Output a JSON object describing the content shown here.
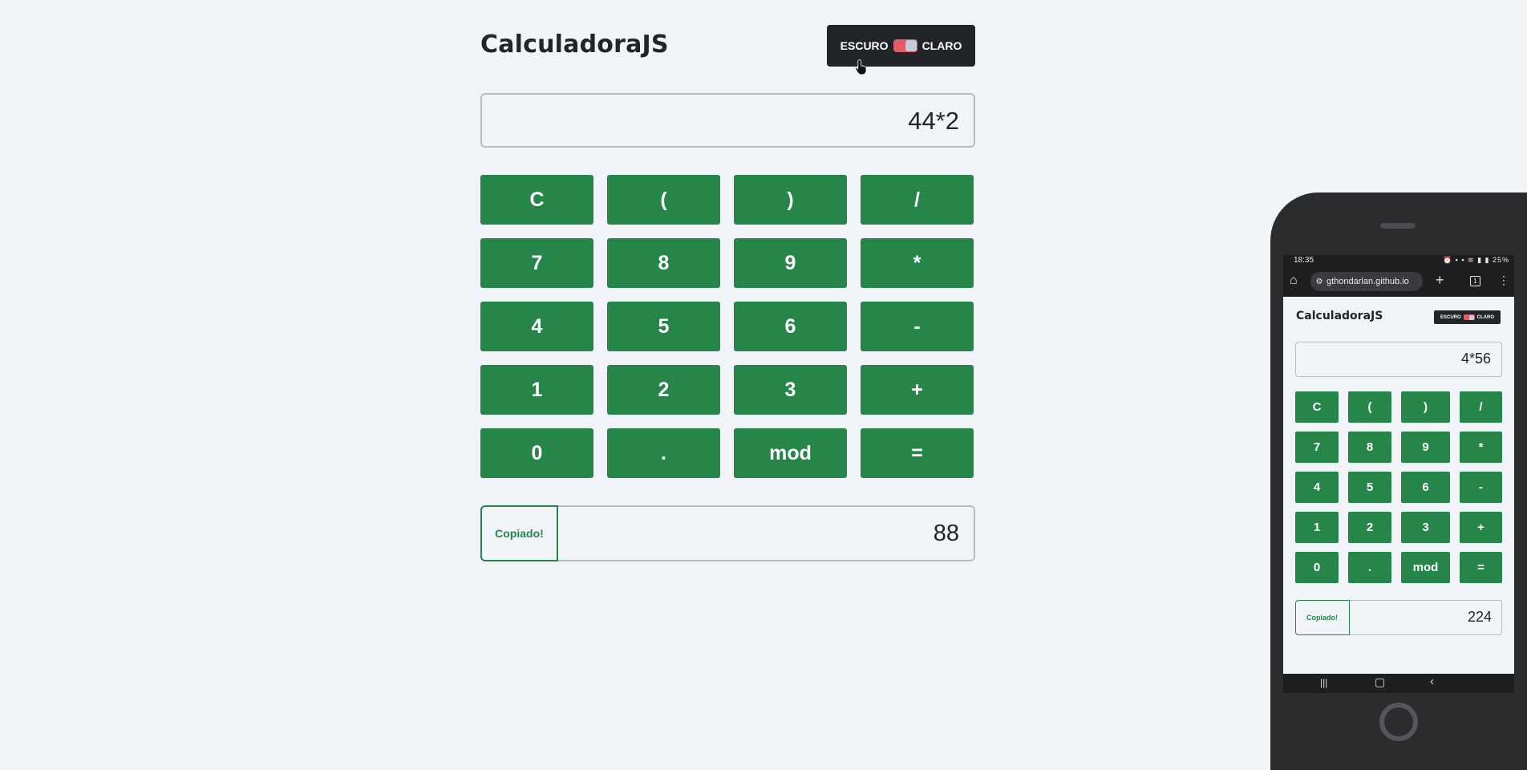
{
  "app": {
    "title": "CalculadoraJS",
    "theme_toggle": {
      "dark_label": "ESCURO",
      "light_label": "CLARO"
    },
    "expression": "44*2",
    "keys": [
      "C",
      "(",
      ")",
      "/",
      "7",
      "8",
      "9",
      "*",
      "4",
      "5",
      "6",
      "-",
      "1",
      "2",
      "3",
      "+",
      "0",
      ".",
      "mod",
      "="
    ],
    "copy_label": "Copiado!",
    "result": "88"
  },
  "phone": {
    "status_time": "18:35",
    "status_battery": "25%",
    "url": "gthondarlan.github.io",
    "tab_count": "1",
    "app": {
      "title": "CalculadoraJS",
      "theme_toggle": {
        "dark_label": "ESCURO",
        "light_label": "CLARO"
      },
      "expression": "4*56",
      "keys": [
        "C",
        "(",
        ")",
        "/",
        "7",
        "8",
        "9",
        "*",
        "4",
        "5",
        "6",
        "-",
        "1",
        "2",
        "3",
        "+",
        "0",
        ".",
        "mod",
        "="
      ],
      "copy_label": "Copiado!",
      "result": "224"
    }
  },
  "colors": {
    "background": "#f0f3f8",
    "key_green": "#26864a",
    "dark": "#212529",
    "toggle_red": "#e55a67"
  }
}
